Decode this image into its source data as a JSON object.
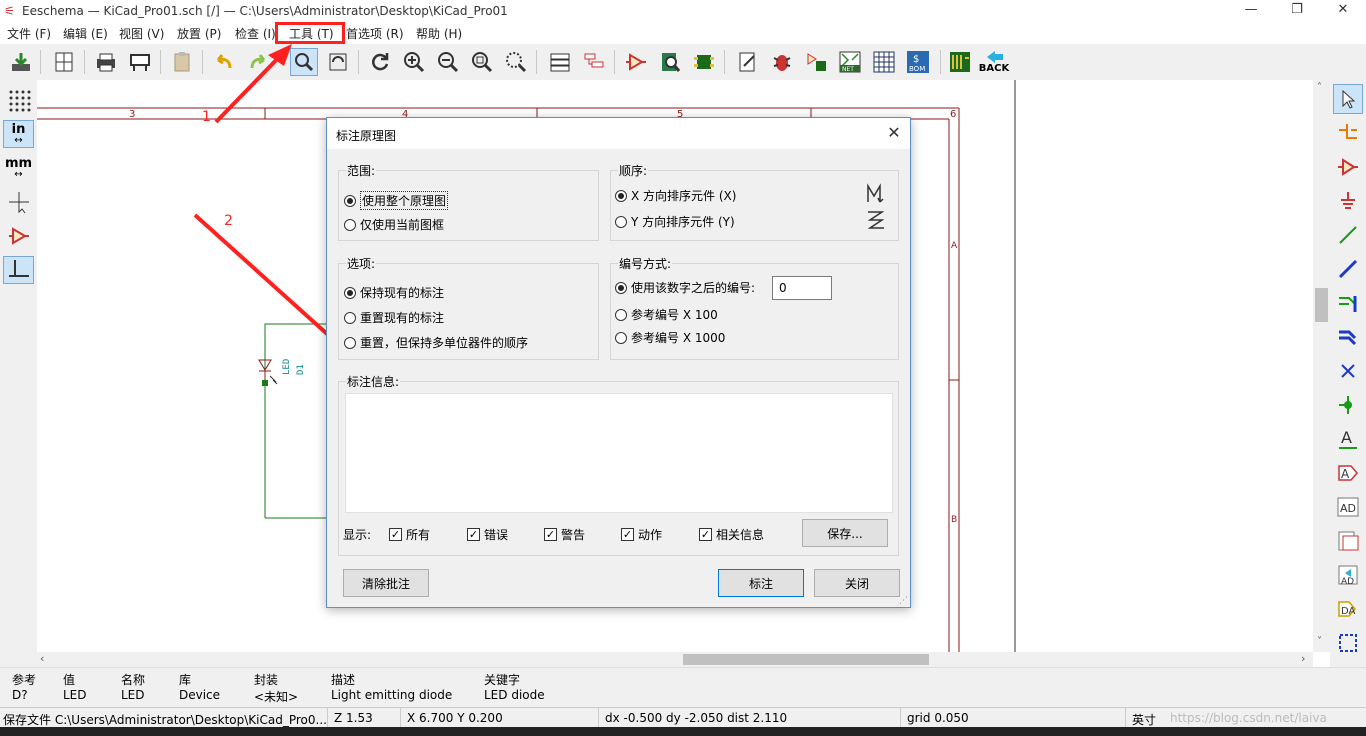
{
  "titlebar": {
    "title": "Eeschema — KiCad_Pro01.sch [/] — C:\\Users\\Administrator\\Desktop\\KiCad_Pro01",
    "min": "—",
    "restore": "❐",
    "close": "✕"
  },
  "menu": [
    "文件 (F)",
    "编辑 (E)",
    "视图 (V)",
    "放置 (P)",
    "检查 (I)",
    "工具 (T)",
    "首选项 (R)",
    "帮助 (H)"
  ],
  "toolbar": {
    "back_label": "BACK",
    "net_label": "NET",
    "bom_label": "BOM"
  },
  "left_toolbar": {
    "in_label": "in",
    "mm_label": "mm"
  },
  "annotations": {
    "arrow1_label": "1",
    "arrow2_label": "2",
    "highlight_color": "#ff2020"
  },
  "schematic": {
    "border_numbers": [
      "3",
      "4",
      "5",
      "6"
    ],
    "border_letters": [
      "A",
      "B"
    ],
    "component_ref": "D1",
    "component_value": "LED"
  },
  "dialog": {
    "title": "标注原理图",
    "scope": {
      "label": "范围:",
      "options": [
        "使用整个原理图",
        "仅使用当前图框"
      ],
      "selected": 0
    },
    "order": {
      "label": "顺序:",
      "options": [
        "X 方向排序元件 (X)",
        "Y 方向排序元件 (Y)"
      ],
      "selected": 0
    },
    "options": {
      "label": "选项:",
      "options": [
        "保持现有的标注",
        "重置现有的标注",
        "重置，但保持多单位器件的顺序"
      ],
      "selected": 0
    },
    "numbering": {
      "label": "编号方式:",
      "options": [
        "使用该数字之后的编号:",
        "参考编号 X 100",
        "参考编号 X 1000"
      ],
      "selected": 0,
      "start_value": "0"
    },
    "messages": {
      "label": "标注信息:"
    },
    "display": {
      "label": "显示:",
      "checks": [
        {
          "label": "所有",
          "checked": true
        },
        {
          "label": "错误",
          "checked": true
        },
        {
          "label": "警告",
          "checked": true
        },
        {
          "label": "动作",
          "checked": true
        },
        {
          "label": "相关信息",
          "checked": true
        }
      ]
    },
    "save_button": "保存...",
    "clear_button": "清除批注",
    "annotate_button": "标注",
    "close_button": "关闭"
  },
  "infobar": {
    "headers": [
      "参考",
      "值",
      "名称",
      "库",
      "封装",
      "描述",
      "关键字"
    ],
    "values": [
      "D?",
      "LED",
      "LED",
      "Device",
      "<未知>",
      "Light emitting diode",
      "LED diode"
    ]
  },
  "statusbar": {
    "message": "保存文件 C:\\Users\\Administrator\\Desktop\\KiCad_Pro0...",
    "zoom": "Z 1.53",
    "coords": "X 6.700  Y 0.200",
    "delta": "dx -0.500  dy -2.050  dist 2.110",
    "grid": "grid 0.050",
    "units": "英寸",
    "watermark": "https://blog.csdn.net/laiva"
  }
}
